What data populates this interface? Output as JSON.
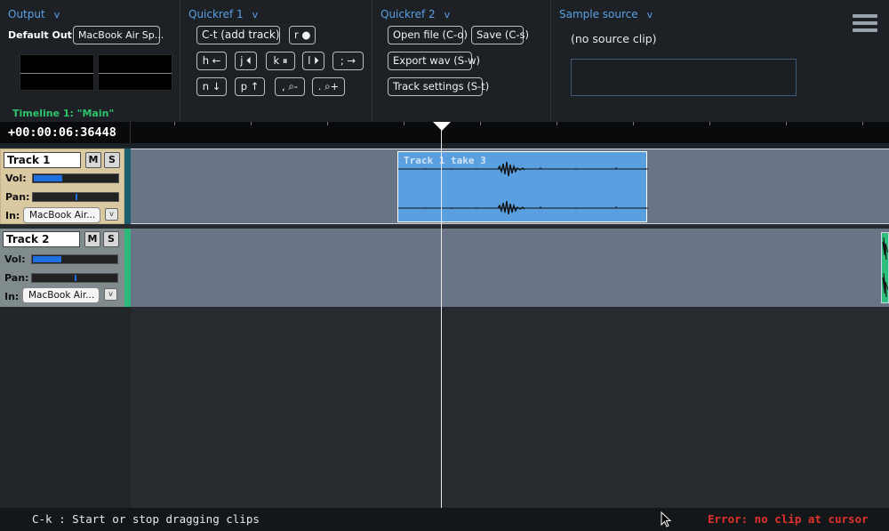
{
  "output": {
    "header": "Output",
    "chevron": "v",
    "default_out_label": "Default Out:",
    "device": "MacBook Air Sp...",
    "timeline_label": "Timeline 1: \"Main\""
  },
  "quickref1": {
    "header": "Quickref 1",
    "chevron": "v",
    "add_track": "C-t (add track)",
    "record": "r ●",
    "h": "h ←",
    "j": "j ⏴",
    "k": "k ⏸",
    "l": "l ⏵",
    "semicolon": "; →",
    "n": "n ↓",
    "p": "p ↑",
    "zoom_out": ", ⌕-",
    "zoom_in": ". ⌕+"
  },
  "quickref2": {
    "header": "Quickref 2",
    "chevron": "v",
    "open_file": "Open file (C-o)",
    "save": "Save (C-s)",
    "export_wav": "Export wav (S-w)",
    "track_settings": "Track settings (S-t)"
  },
  "sample_source": {
    "header": "Sample source",
    "chevron": "v",
    "empty_text": "(no source clip)"
  },
  "ruler": {
    "timecode": "+00:00:06:36448"
  },
  "tracks": [
    {
      "name": "Track 1",
      "mute": "M",
      "solo": "S",
      "vol_label": "Vol:",
      "pan_label": "Pan:",
      "in_label": "In:",
      "input": "MacBook Air...",
      "dropdown": "v",
      "volume": 0.33,
      "pan": 0.5,
      "color": "#d9c8a0",
      "clips": [
        {
          "title": "Track 1 take 3"
        }
      ]
    },
    {
      "name": "Track 2",
      "mute": "M",
      "solo": "S",
      "vol_label": "Vol:",
      "pan_label": "Pan:",
      "in_label": "In:",
      "input": "MacBook Air...",
      "dropdown": "v",
      "volume": 0.33,
      "pan": 0.5,
      "color": "#7f8b8d"
    }
  ],
  "status": {
    "message": "C-k : Start or stop dragging clips",
    "error": "Error: no clip at cursor"
  },
  "colors": {
    "accent": "#5aa0e6",
    "timeline_label": "#2fc46c",
    "clip": "#5aa0e0",
    "error": "#e0312c"
  }
}
